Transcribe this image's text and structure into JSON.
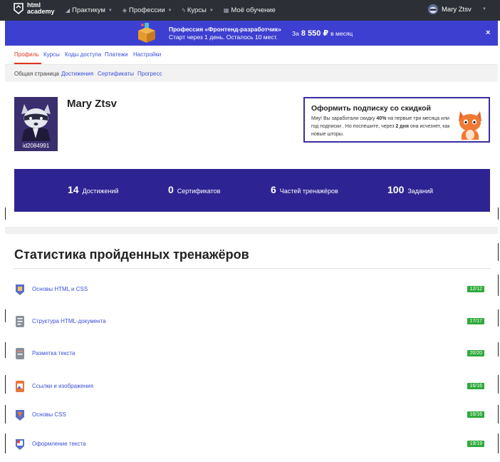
{
  "topbar": {
    "logo_line1": "html",
    "logo_line2": "academy",
    "nav": [
      {
        "label": "Практикум",
        "icon": "chart-icon",
        "has_menu": true
      },
      {
        "label": "Профессии",
        "icon": "cap-icon",
        "has_menu": true
      },
      {
        "label": "Курсы",
        "icon": "bolt-icon",
        "has_menu": true
      },
      {
        "label": "Моё обучение",
        "icon": "dash-icon",
        "has_menu": false
      }
    ],
    "user_name": "Mary Ztsv"
  },
  "promo": {
    "title": "Профессия «Фронтенд-разработчик»",
    "subtitle": "Старт через 1 день. Осталось 10 мест.",
    "price_prefix": "За",
    "price": "8 550 ₽",
    "price_suffix": "в месяц",
    "close": "×"
  },
  "tabs": [
    "Профиль",
    "Курсы",
    "Коды доступа",
    "Платежи",
    "Настройки"
  ],
  "subtabs": [
    "Общая страница",
    "Достижения",
    "Сертификаты",
    "Прогресс"
  ],
  "profile": {
    "name": "Mary Ztsv",
    "id": "id2084991"
  },
  "offer": {
    "title": "Оформить подписку со скидкой",
    "text_1": "Мяу! Вы заработали скидку ",
    "discount": "40%",
    "text_2": " на первые три месяца или год подписки . Но поспешите, через ",
    "days": "2 дня",
    "text_3": " она исчезнет, как новые шторы."
  },
  "stats": [
    {
      "value": "14",
      "label": "Достижений"
    },
    {
      "value": "0",
      "label": "Сертификатов"
    },
    {
      "value": "6",
      "label": "Частей тренажёров"
    },
    {
      "value": "100",
      "label": "Заданий"
    }
  ],
  "trainers": {
    "title": "Статистика пройденных тренажёров",
    "items": [
      {
        "label": "Основы HTML и CSS",
        "progress": "12/12",
        "icon_color": "#5a6ec8"
      },
      {
        "label": "Структура HTML-документа",
        "progress": "17/17",
        "icon_color": "#8a8f98"
      },
      {
        "label": "Разметка текста",
        "progress": "20/20",
        "icon_color": "#8a8f98"
      },
      {
        "label": "Ссылки и изображения",
        "progress": "16/16",
        "icon_color": "#e8743a"
      },
      {
        "label": "Основы CSS",
        "progress": "16/16",
        "icon_color": "#5a6ec8"
      },
      {
        "label": "Оформление текста",
        "progress": "19/19",
        "icon_color": "#e04a3a"
      }
    ]
  },
  "colors": {
    "topbar": "#2c3036",
    "promo": "#3d3fd0",
    "stats": "#2d2392",
    "link": "#3a4fd8",
    "active_tab": "#e0341e",
    "badge": "#2eaa3a"
  }
}
